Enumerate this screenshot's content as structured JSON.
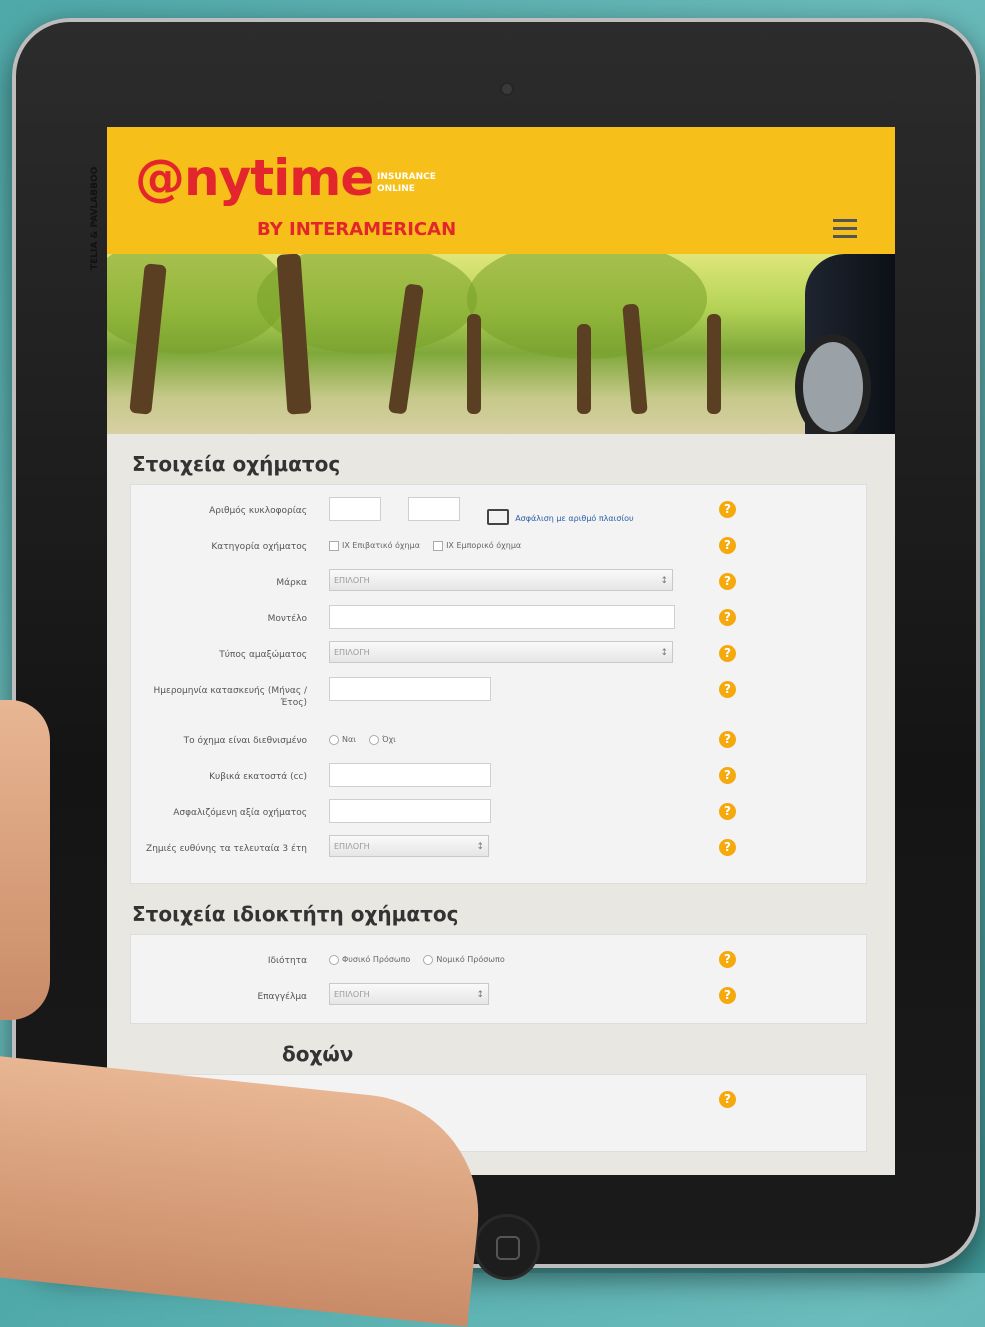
{
  "site": {
    "logo": "@nytime",
    "logo_tag_line1": "INSURANCE",
    "logo_tag_line2": "ONLINE",
    "logo_by": "BY INTERAMERICAN",
    "menu_icon": "hamburger-icon"
  },
  "photo_credit": "TELIA & PAVLABBOO",
  "vehicle_section": {
    "title": "Στοιχεία οχήματος",
    "rows": [
      {
        "label": "Αριθμός κυκλοφορίας",
        "link": "Ασφάλιση με αριθμό πλαισίου"
      },
      {
        "label": "Κατηγορία οχήματος",
        "options": [
          "ΙΧ Επιβατικό όχημα",
          "ΙΧ Εμπορικό όχημα"
        ]
      },
      {
        "label": "Μάρκα",
        "value": "ΕΠΙΛΟΓΗ"
      },
      {
        "label": "Μοντέλο"
      },
      {
        "label": "Τύπος αμαξώματος",
        "value": "ΕΠΙΛΟΓΗ"
      },
      {
        "label": "Ημερομηνία κατασκευής (Μήνας / Έτος)"
      },
      {
        "label": "Το όχημα είναι διεθνισμένο",
        "options": [
          "Ναι",
          "Όχι"
        ]
      },
      {
        "label": "Κυβικά εκατοστά (cc)"
      },
      {
        "label": "Ασφαλιζόμενη αξία οχήματος"
      },
      {
        "label": "Ζημιές ευθύνης τα τελευταία 3 έτη",
        "value": "ΕΠΙΛΟΓΗ"
      }
    ]
  },
  "owner_section": {
    "title": "Στοιχεία ιδιοκτήτη οχήματος",
    "rows": [
      {
        "label": "Ιδιότητα",
        "options": [
          "Φυσικό Πρόσωπο",
          "Νομικό Πρόσωπο"
        ]
      },
      {
        "label": "Επαγγέλμα",
        "value": "ΕΠΙΛΟΓΗ"
      }
    ]
  },
  "third_section": {
    "title": "δοχών"
  },
  "help_symbol": "?"
}
